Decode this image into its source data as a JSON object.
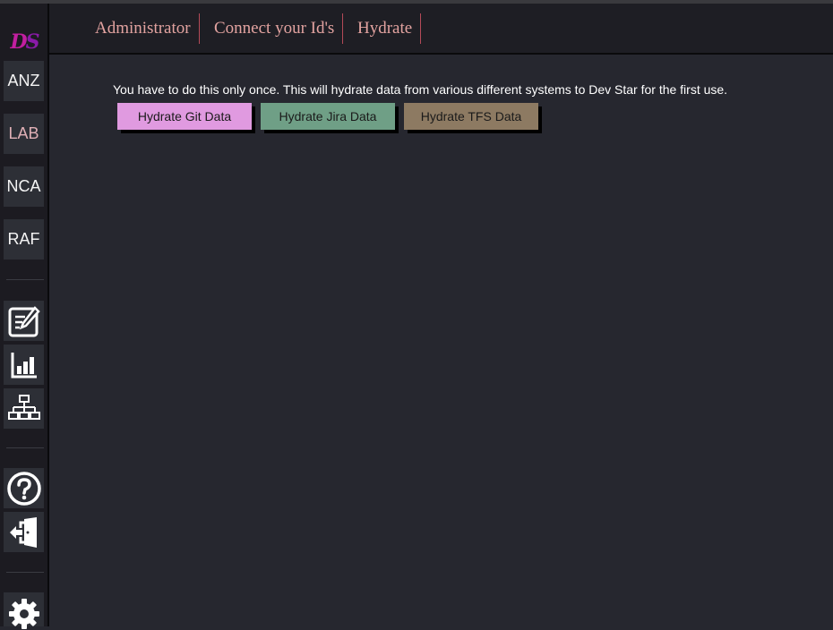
{
  "sidebar": {
    "logo": {
      "letters": "DS"
    },
    "orgs": [
      {
        "label": "ANZ",
        "active": false
      },
      {
        "label": "LAB",
        "active": true
      },
      {
        "label": "NCA",
        "active": false
      },
      {
        "label": "RAF",
        "active": false
      }
    ],
    "tools": [
      {
        "icon": "edit-icon"
      },
      {
        "icon": "bar-chart-icon"
      },
      {
        "icon": "hierarchy-icon"
      }
    ],
    "help": {
      "icon": "help-icon"
    },
    "logout": {
      "icon": "logout-icon"
    },
    "settings": {
      "icon": "gear-icon"
    }
  },
  "header": {
    "tabs": [
      {
        "label": "Administrator"
      },
      {
        "label": "Connect your Id's"
      },
      {
        "label": "Hydrate"
      }
    ]
  },
  "main": {
    "info_text": "You have to do this only once. This will hydrate data from various different systems to Dev Star for the first use.",
    "buttons": [
      {
        "label": "Hydrate Git Data",
        "color": "#e09ae0"
      },
      {
        "label": "Hydrate Jira Data",
        "color": "#6f9f86"
      },
      {
        "label": "Hydrate TFS Data",
        "color": "#8d7a62"
      }
    ]
  }
}
